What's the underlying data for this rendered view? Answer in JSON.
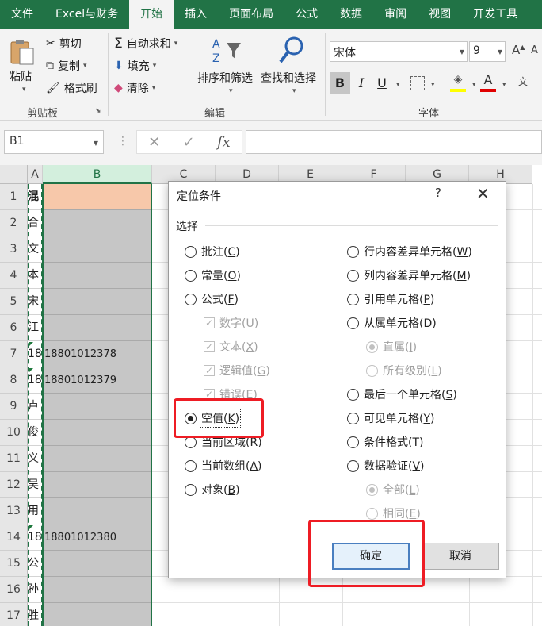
{
  "ribbon_tabs": [
    "文件",
    "Excel与财务",
    "开始",
    "插入",
    "页面布局",
    "公式",
    "数据",
    "审阅",
    "视图",
    "开发工具"
  ],
  "active_tab": "开始",
  "clipboard": {
    "paste": "粘贴",
    "cut": "剪切",
    "copy": "复制",
    "format_painter": "格式刷",
    "group": "剪贴板"
  },
  "editing": {
    "autosum": "自动求和",
    "fill": "填充",
    "clear": "清除",
    "sort_filter": "排序和筛选",
    "find_select": "查找和选择",
    "group": "编辑"
  },
  "font": {
    "name": "宋体",
    "size": "9",
    "group": "字体",
    "bold": "B",
    "italic": "I",
    "underline": "U"
  },
  "formula_bar": {
    "name_box": "B1",
    "fx": "fx",
    "cancel": "✕",
    "enter": "✓"
  },
  "sheet": {
    "columns": [
      "A",
      "B",
      "C",
      "D",
      "E",
      "F",
      "G",
      "H"
    ],
    "rows": [
      "1",
      "2",
      "3",
      "4",
      "5",
      "6",
      "7",
      "8",
      "9",
      "10",
      "11",
      "12",
      "13",
      "14",
      "15",
      "16",
      "17"
    ],
    "col_a": [
      "混",
      "合",
      "文",
      "本",
      "宋",
      "江",
      "18",
      "18",
      "卢",
      "俊",
      "义",
      "吴",
      "用",
      "18",
      "公",
      "孙",
      "胜"
    ],
    "col_b": [
      "",
      "",
      "",
      "",
      "",
      "",
      "18801012378",
      "18801012379",
      "",
      "",
      "",
      "",
      "",
      "18801012380",
      "",
      "",
      ""
    ]
  },
  "dialog": {
    "title": "定位条件",
    "help": "?",
    "close": "✕",
    "section": "选择",
    "left_options": [
      {
        "label": "批注",
        "key": "C"
      },
      {
        "label": "常量",
        "key": "O"
      },
      {
        "label": "公式",
        "key": "F"
      },
      {
        "label": "数字",
        "key": "U"
      },
      {
        "label": "文本",
        "key": "X"
      },
      {
        "label": "逻辑值",
        "key": "G"
      },
      {
        "label": "错误",
        "key": "E"
      },
      {
        "label": "空值",
        "key": "K"
      },
      {
        "label": "当前区域",
        "key": "R"
      },
      {
        "label": "当前数组",
        "key": "A"
      },
      {
        "label": "对象",
        "key": "B"
      }
    ],
    "right_options": [
      {
        "label": "行内容差异单元格",
        "key": "W"
      },
      {
        "label": "列内容差异单元格",
        "key": "M"
      },
      {
        "label": "引用单元格",
        "key": "P"
      },
      {
        "label": "从属单元格",
        "key": "D"
      },
      {
        "label": "直属",
        "key": "I"
      },
      {
        "label": "所有级别",
        "key": "L"
      },
      {
        "label": "最后一个单元格",
        "key": "S"
      },
      {
        "label": "可见单元格",
        "key": "Y"
      },
      {
        "label": "条件格式",
        "key": "T"
      },
      {
        "label": "数据验证",
        "key": "V"
      },
      {
        "label": "全部",
        "key": "L"
      },
      {
        "label": "相同",
        "key": "E"
      }
    ],
    "selected": "空值",
    "ok": "确定",
    "cancel": "取消"
  },
  "colors": {
    "excel_green": "#217346",
    "annotation_red": "#ee1c24",
    "selection_gray": "#c6c6c6",
    "header_cell": "#f7c8aa"
  }
}
